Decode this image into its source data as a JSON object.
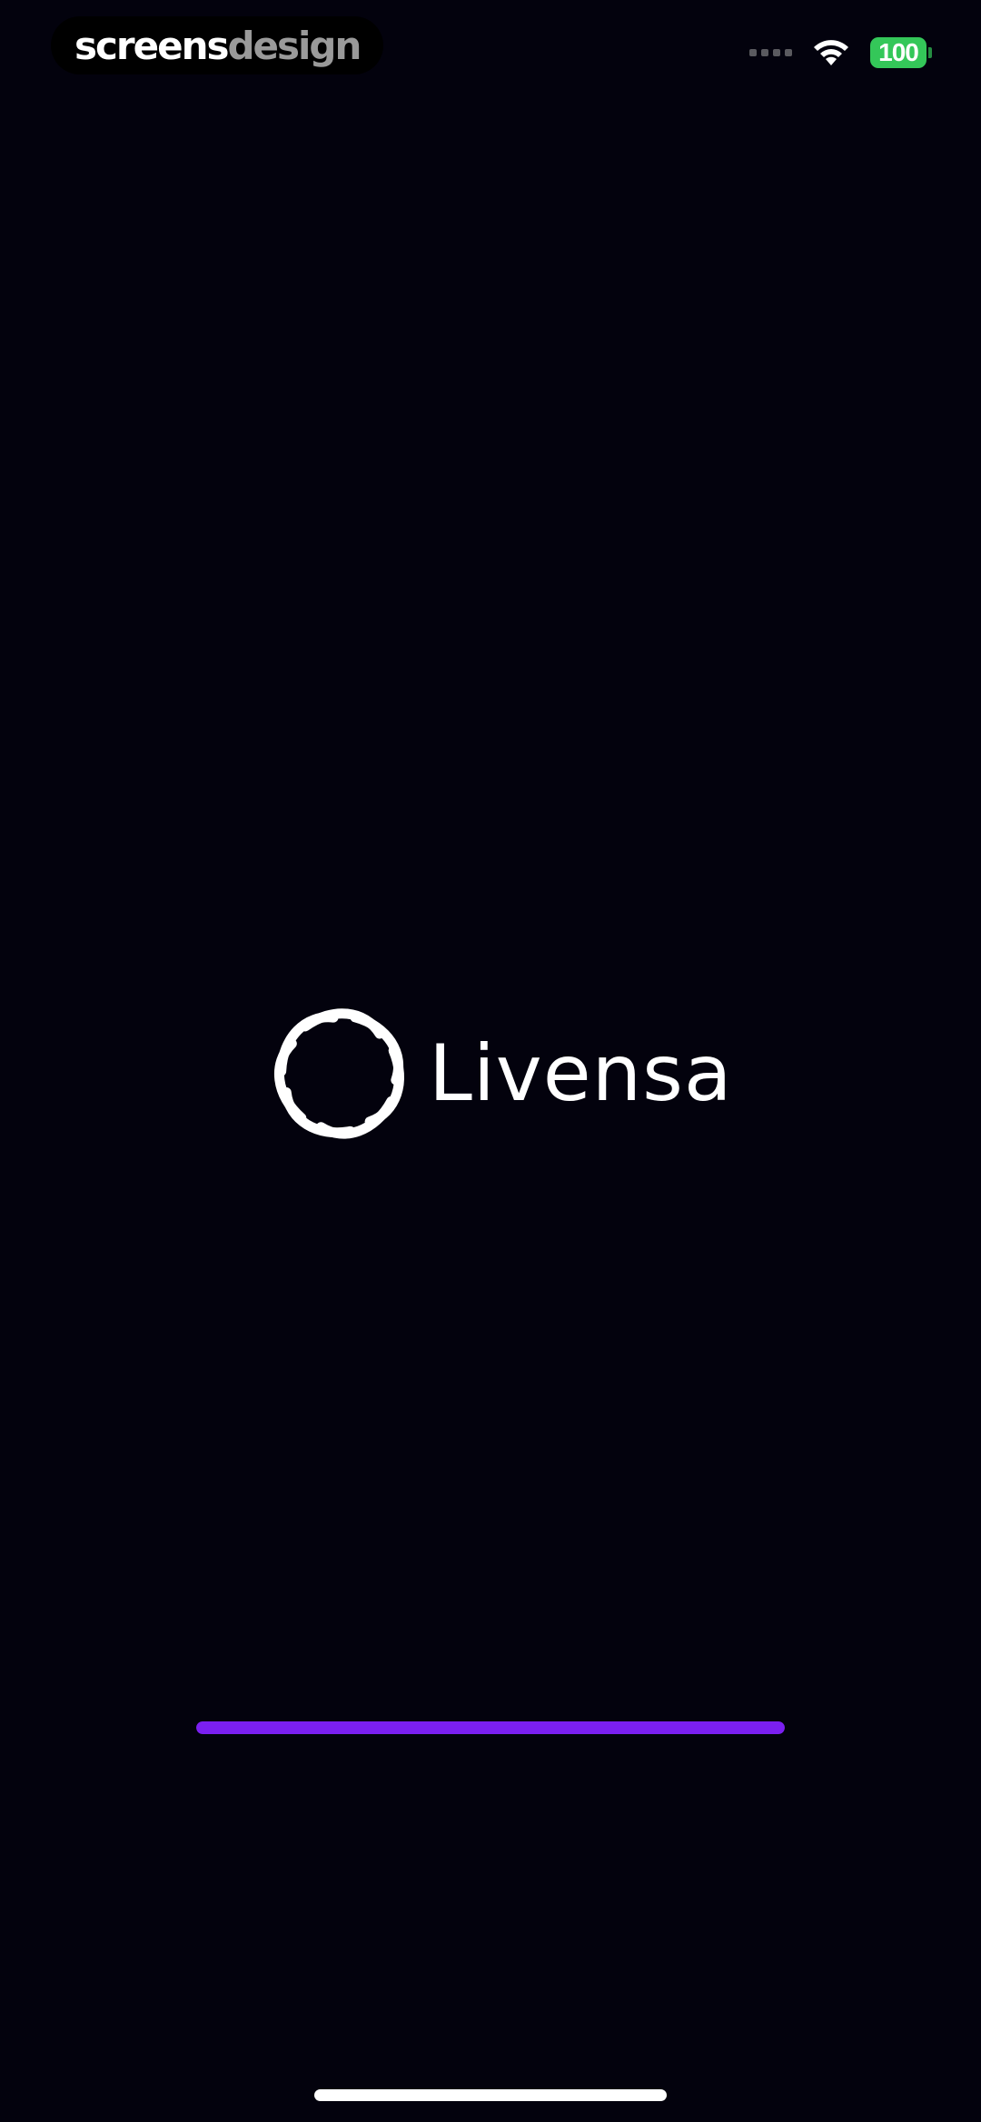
{
  "watermark": {
    "part1": "screens",
    "part2": "design"
  },
  "status_bar": {
    "battery_level": "100",
    "signal_icon": "cellular-signal-icon",
    "wifi_icon": "wifi-icon",
    "battery_color": "#34c759"
  },
  "brand": {
    "name": "Livensa",
    "logo_icon": "interlaced-knot-logo-icon"
  },
  "loading": {
    "progress": 1.0,
    "color": "#7b1ff0"
  },
  "colors": {
    "background": "#03020d",
    "accent": "#7b1ff0"
  }
}
